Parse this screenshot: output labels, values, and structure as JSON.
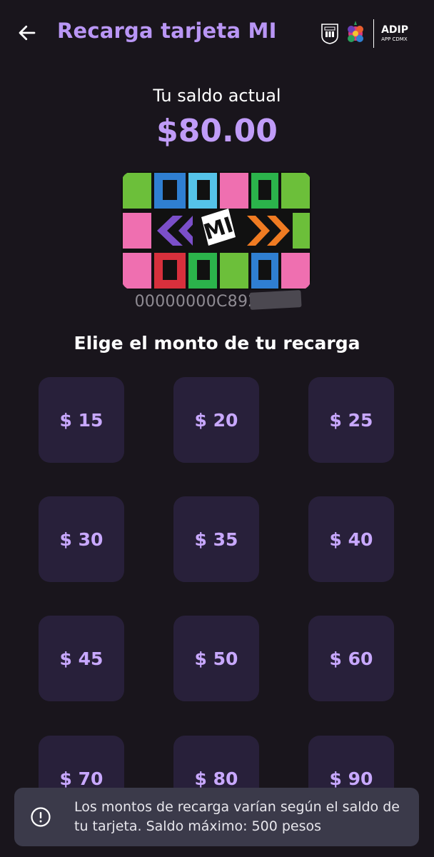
{
  "header": {
    "title": "Recarga tarjeta MI",
    "back_icon": "arrow-left-icon",
    "logo_text": "ADIP",
    "logo_subtext": "APP CDMX"
  },
  "balance": {
    "label": "Tu saldo actual",
    "value": "$80.00"
  },
  "card": {
    "logo_text": "MI",
    "number": "00000000C892?D00"
  },
  "amounts": {
    "title": "Elige el monto de tu recarga",
    "options": [
      "$ 15",
      "$ 20",
      "$ 25",
      "$ 30",
      "$ 35",
      "$ 40",
      "$ 45",
      "$ 50",
      "$ 60",
      "$ 70",
      "$ 80",
      "$ 90"
    ]
  },
  "notice": {
    "icon": "info-icon",
    "text": "Los montos de recarga varían según el saldo de tu tarjeta. Saldo máximo: 500 pesos"
  },
  "colors": {
    "background": "#19151c",
    "accent": "#b996f5",
    "button_bg": "#28203a",
    "snackbar_bg": "#3b3a4a"
  }
}
